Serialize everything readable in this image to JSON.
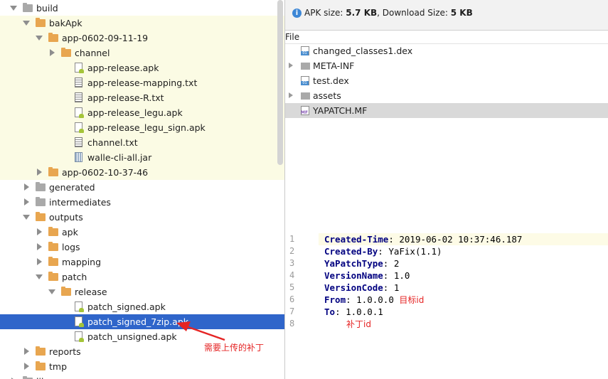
{
  "tree": {
    "items": [
      {
        "label": "build",
        "arrow": "down",
        "icon": "folder-gray-icon"
      },
      {
        "label": "bakApk",
        "arrow": "down",
        "icon": "folder-orange-icon"
      },
      {
        "label": "app-0602-09-11-19",
        "arrow": "down",
        "icon": "folder-orange-icon"
      },
      {
        "label": "channel",
        "arrow": "right",
        "icon": "folder-orange-icon"
      },
      {
        "label": "app-release.apk",
        "icon": "apk-file-icon"
      },
      {
        "label": "app-release-mapping.txt",
        "icon": "text-file-icon"
      },
      {
        "label": "app-release-R.txt",
        "icon": "text-file-icon"
      },
      {
        "label": "app-release_legu.apk",
        "icon": "apk-file-icon"
      },
      {
        "label": "app-release_legu_sign.apk",
        "icon": "apk-file-icon"
      },
      {
        "label": "channel.txt",
        "icon": "text-file-icon"
      },
      {
        "label": "walle-cli-all.jar",
        "icon": "jar-file-icon"
      },
      {
        "label": "app-0602-10-37-46",
        "arrow": "right",
        "icon": "folder-orange-icon"
      },
      {
        "label": "generated",
        "arrow": "right",
        "icon": "folder-gray-icon"
      },
      {
        "label": "intermediates",
        "arrow": "right",
        "icon": "folder-gray-icon"
      },
      {
        "label": "outputs",
        "arrow": "down",
        "icon": "folder-orange-icon"
      },
      {
        "label": "apk",
        "arrow": "right",
        "icon": "folder-orange-icon"
      },
      {
        "label": "logs",
        "arrow": "right",
        "icon": "folder-orange-icon"
      },
      {
        "label": "mapping",
        "arrow": "right",
        "icon": "folder-orange-icon"
      },
      {
        "label": "patch",
        "arrow": "down",
        "icon": "folder-orange-icon"
      },
      {
        "label": "release",
        "arrow": "down",
        "icon": "folder-orange-icon"
      },
      {
        "label": "patch_signed.apk",
        "icon": "apk-file-icon"
      },
      {
        "label": "patch_signed_7zip.apk",
        "icon": "apk-file-icon",
        "selected": true
      },
      {
        "label": "patch_unsigned.apk",
        "icon": "apk-file-icon"
      },
      {
        "label": "reports",
        "arrow": "right",
        "icon": "folder-orange-icon"
      },
      {
        "label": "tmp",
        "arrow": "right",
        "icon": "folder-orange-icon"
      },
      {
        "label": "lib",
        "arrow": "right",
        "icon": "folder-gray-icon"
      }
    ]
  },
  "apk": {
    "size_label": "APK size: ",
    "size_value": "5.7 KB",
    "download_label": ", Download Size: ",
    "download_value": "5 KB",
    "file_column": "File",
    "files": [
      {
        "name": "changed_classes1.dex",
        "icon": "dex-file-icon"
      },
      {
        "name": "META-INF",
        "icon": "folder-icon",
        "expandable": true
      },
      {
        "name": "test.dex",
        "icon": "dex-file-icon"
      },
      {
        "name": "assets",
        "icon": "folder-icon",
        "expandable": true
      },
      {
        "name": "YAPATCH.MF",
        "icon": "manifest-file-icon",
        "selected": true
      }
    ]
  },
  "editor": {
    "line_numbers": [
      "1",
      "2",
      "3",
      "4",
      "5",
      "6",
      "7",
      "8"
    ],
    "lines": [
      {
        "key": "Created-Time",
        "value": ": 2019-06-02 10:37:46.187"
      },
      {
        "key": "Created-By",
        "value": ": YaFix(1.1)"
      },
      {
        "key": "YaPatchType",
        "value": ": 2"
      },
      {
        "key": "VersionName",
        "value": ": 1.0"
      },
      {
        "key": "VersionCode",
        "value": ": 1"
      },
      {
        "key": "From",
        "value": ": 1.0.0.0 "
      },
      {
        "key": "To",
        "value": ": 1.0.0.1"
      }
    ],
    "note_target": "目标id",
    "note_patch": "补丁id"
  },
  "annotation": {
    "text": "需要上传的补丁",
    "color": "#e52424"
  }
}
